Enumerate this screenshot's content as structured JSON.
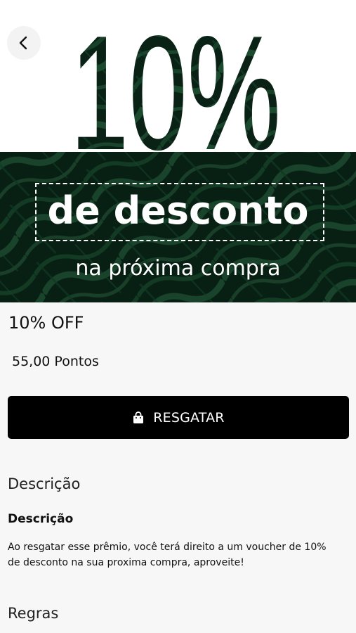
{
  "hero": {
    "percent_text": "10%",
    "discount_text": "de desconto",
    "subline_text": "na próxima compra"
  },
  "navigation": {
    "back_icon": "chevron-left-icon"
  },
  "offer": {
    "title": "10% OFF",
    "points": "55,00 Pontos"
  },
  "redeem": {
    "label": "RESGATAR",
    "icon": "shopping-bag-icon"
  },
  "description": {
    "heading": "Descrição",
    "subtitle": "Descrição",
    "text": "Ao resgatar esse prêmio, você terá direito a um voucher de 10% de desconto na sua proxima compra, aproveite!"
  },
  "rules": {
    "heading": "Regras"
  },
  "colors": {
    "page_background": "#f7f7f7",
    "button_background": "#000000",
    "button_text": "#ffffff",
    "banner_dark_green": "#0d2a1d",
    "banner_leaf_green": "#2f6b45"
  }
}
